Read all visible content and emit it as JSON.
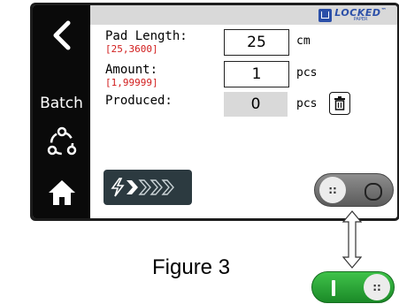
{
  "sidebar": {
    "back_icon": "chevron-left-icon",
    "batch_label": "Batch",
    "cycle_icon": "cycle-icon",
    "home_icon": "home-icon"
  },
  "header": {
    "logo_main": "LOCKED",
    "logo_tm": "™",
    "logo_sub": "PAPER"
  },
  "fields": {
    "pad_length": {
      "label": "Pad Length:",
      "range": "[25,3600]",
      "value": "25",
      "unit": "cm"
    },
    "amount": {
      "label": "Amount:",
      "range": "[1,99999]",
      "value": "1",
      "unit": "pcs"
    },
    "produced": {
      "label": "Produced:",
      "value": "0",
      "unit": "pcs"
    }
  },
  "controls": {
    "trash_icon": "trash-icon",
    "start_icon": "lightning-forward-icon",
    "toggle_off_knob": "::",
    "toggle_on_knob": "::"
  },
  "caption": "Figure 3",
  "colors": {
    "sidebar": "#0a0a0a",
    "header": "#d9d9d9",
    "range_text": "#d11c1c",
    "start_button": "#2c3a40",
    "toggle_on": "#2aa835",
    "toggle_off": "#6e6e6e",
    "logo": "#2b4fa8"
  }
}
